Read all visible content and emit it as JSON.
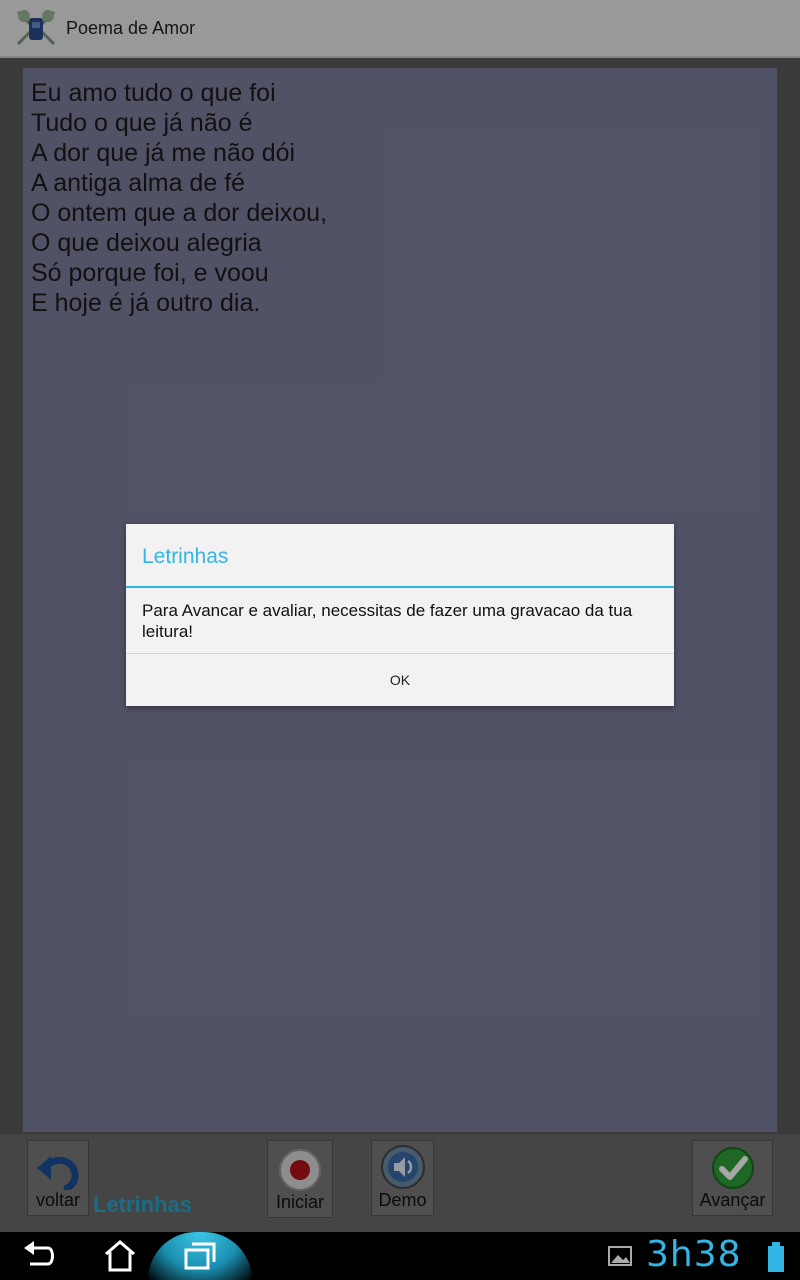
{
  "app": {
    "title": "Poema de Amor"
  },
  "poem": {
    "lines": [
      "Eu amo tudo o que foi",
      "Tudo o que já não é",
      "A dor que já me não dói",
      "A antiga alma de fé",
      "O ontem que a dor deixou,",
      "O que deixou alegria",
      "Só porque foi, e voou",
      "E hoje é já outro dia."
    ]
  },
  "toolbar": {
    "back_label": "voltar",
    "brand": "Letrinhas",
    "record_label": "Iniciar",
    "demo_label": "Demo",
    "next_label": "Avançar"
  },
  "dialog": {
    "title": "Letrinhas",
    "message": "Para Avancar e avaliar, necessitas de fazer uma gravacao da tua leitura!",
    "ok_label": "OK"
  },
  "system": {
    "clock": "3h38"
  },
  "colors": {
    "accent": "#33b5e5",
    "brand_text": "#2aa8cc",
    "panel": "#7e7f9e",
    "record_red": "#b3121b",
    "check_green": "#2e9e3a"
  },
  "icons": {
    "app": "app-logo-icon",
    "back": "undo-arrow-icon",
    "record": "record-icon",
    "demo": "speaker-icon",
    "next": "checkmark-icon",
    "nav_back": "back-icon",
    "nav_home": "home-icon",
    "nav_recents": "recent-apps-icon",
    "gallery": "gallery-icon",
    "battery": "battery-icon"
  }
}
